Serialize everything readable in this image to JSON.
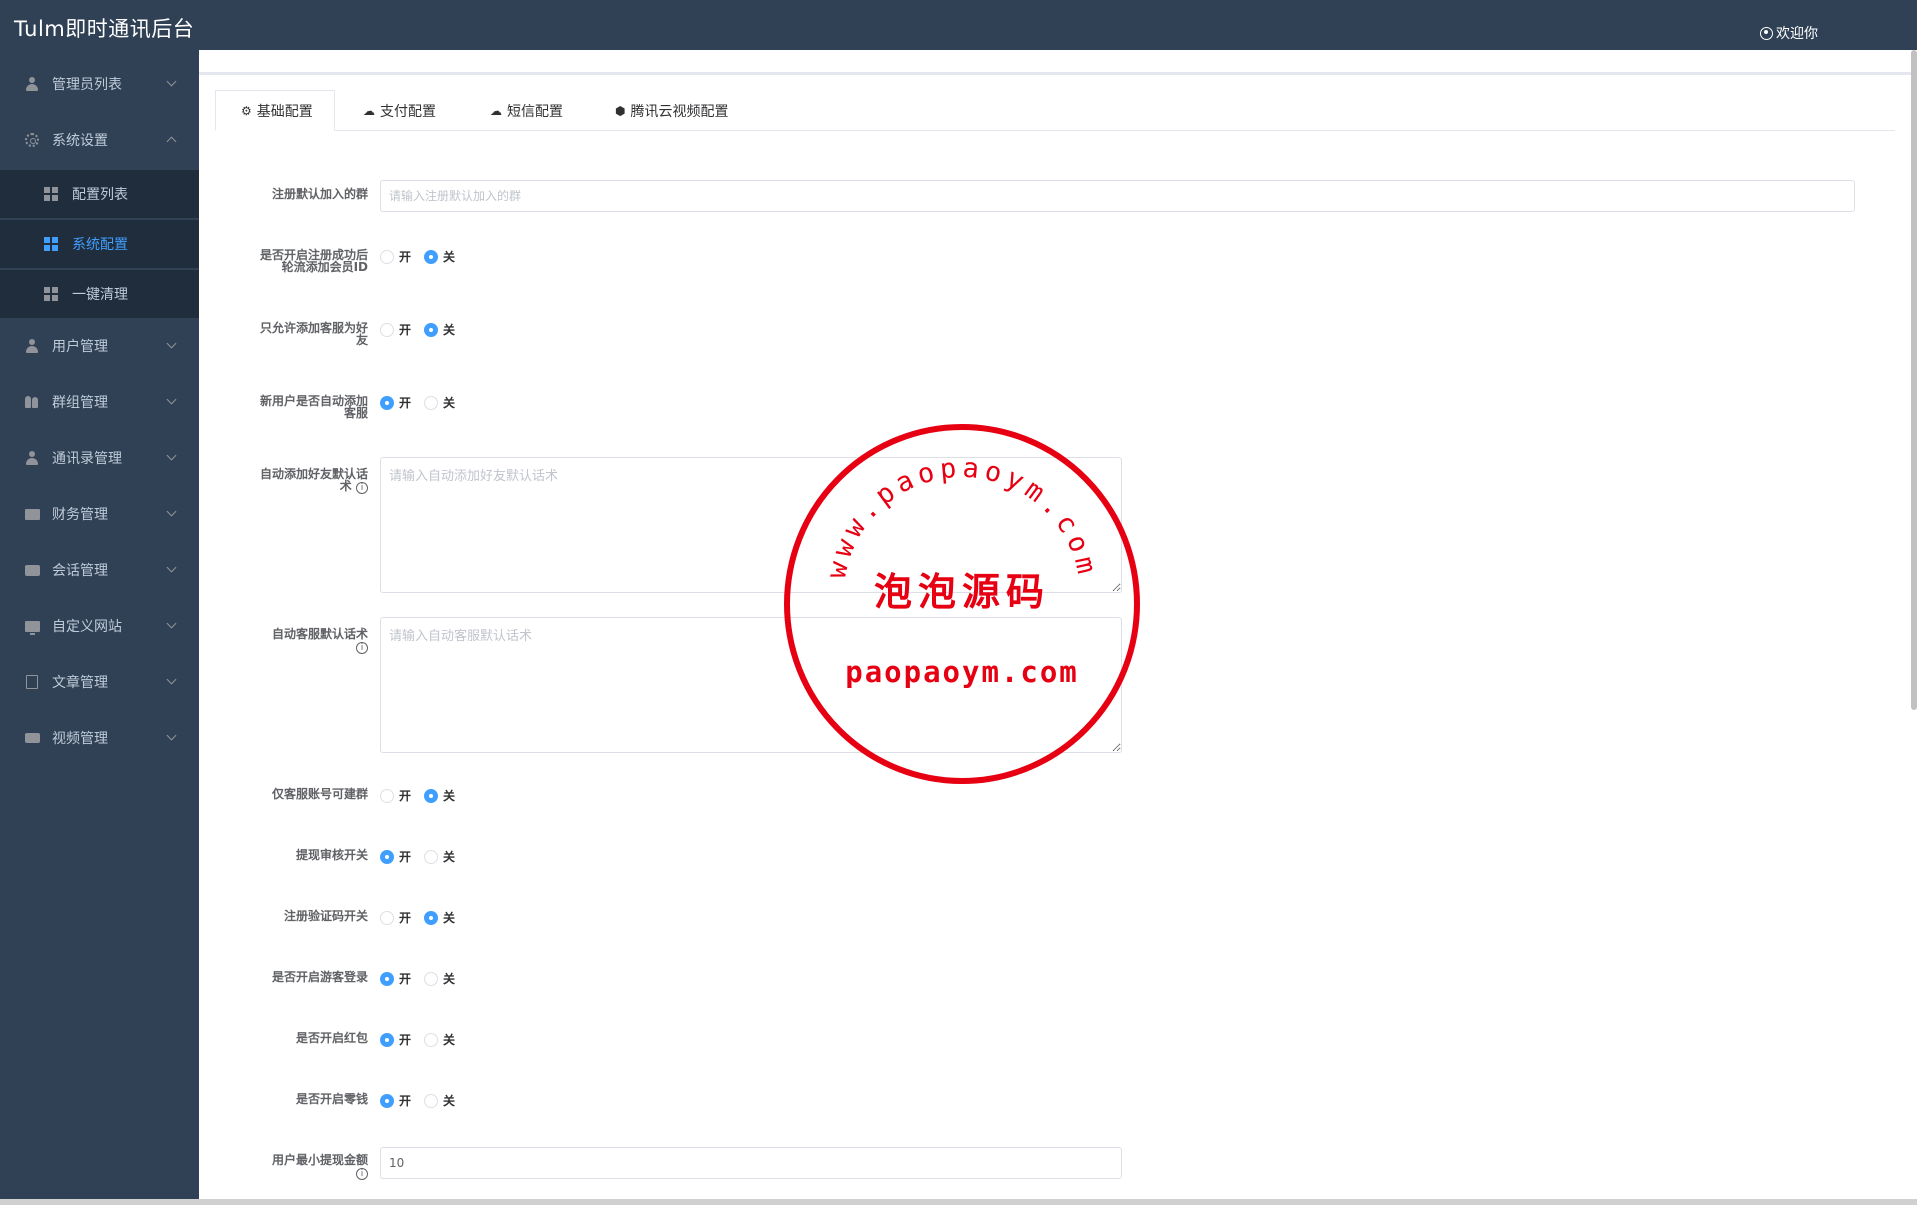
{
  "app": {
    "title": "Tulm即时通讯后台",
    "welcome": "欢迎你"
  },
  "sidebar": {
    "items": [
      {
        "label": "管理员列表",
        "icon": "user-icon"
      },
      {
        "label": "系统设置",
        "icon": "gear-icon"
      },
      {
        "label": "配置列表",
        "icon": "grid-icon"
      },
      {
        "label": "系统配置",
        "icon": "grid-icon"
      },
      {
        "label": "一键清理",
        "icon": "grid-icon"
      },
      {
        "label": "用户管理",
        "icon": "user-icon"
      },
      {
        "label": "群组管理",
        "icon": "group-icon"
      },
      {
        "label": "通讯录管理",
        "icon": "user-icon"
      },
      {
        "label": "财务管理",
        "icon": "wallet-icon"
      },
      {
        "label": "会话管理",
        "icon": "chat-icon"
      },
      {
        "label": "自定义网站",
        "icon": "monitor-icon"
      },
      {
        "label": "文章管理",
        "icon": "document-icon"
      },
      {
        "label": "视频管理",
        "icon": "video-icon"
      }
    ],
    "active": "系统配置"
  },
  "tabs": [
    {
      "label": "基础配置",
      "icon": "gear-icon",
      "active": true
    },
    {
      "label": "支付配置",
      "icon": "cloud-upload-icon",
      "active": false
    },
    {
      "label": "短信配置",
      "icon": "cloud-upload-icon",
      "active": false
    },
    {
      "label": "腾讯云视频配置",
      "icon": "cube-icon",
      "active": false
    }
  ],
  "form": {
    "on_label": "开",
    "off_label": "关",
    "fields": {
      "default_group": {
        "label": "注册默认加入的群",
        "placeholder": "请输入注册默认加入的群",
        "value": ""
      },
      "rotate_member": {
        "label_line1": "是否开启注册成功后",
        "label_line2": "轮流添加会员ID",
        "value": "关"
      },
      "only_service_friend": {
        "label_line1": "只允许添加客服为好",
        "label_line2": "友",
        "value": "关"
      },
      "auto_add_service": {
        "label_line1": "新用户是否自动添加",
        "label_line2": "客服",
        "value": "开"
      },
      "auto_friend_msg": {
        "label_line1": "自动添加好友默认话",
        "label_line2": "术",
        "placeholder": "请输入自动添加好友默认话术",
        "value": ""
      },
      "auto_service_msg": {
        "label_line1": "自动客服默认话术",
        "placeholder": "请输入自动客服默认话术",
        "value": ""
      },
      "service_create_group": {
        "label": "仅客服账号可建群",
        "value": "关"
      },
      "withdraw_review": {
        "label": "提现审核开关",
        "value": "开"
      },
      "register_captcha": {
        "label": "注册验证码开关",
        "value": "关"
      },
      "guest_login": {
        "label": "是否开启游客登录",
        "value": "开"
      },
      "red_packet": {
        "label": "是否开启红包",
        "value": "开"
      },
      "change": {
        "label": "是否开启零钱",
        "value": "开"
      },
      "min_withdraw": {
        "label": "用户最小提现金额",
        "value": "10"
      }
    }
  },
  "watermark": {
    "arc_text": "www.paopaoym.com",
    "cn_text": "泡泡源码",
    "url_text": "paopaoym.com",
    "color": "#e60012"
  },
  "colors": {
    "sidebar_bg": "#304156",
    "accent": "#409eff",
    "submenu_bg": "#1f2d3d"
  }
}
